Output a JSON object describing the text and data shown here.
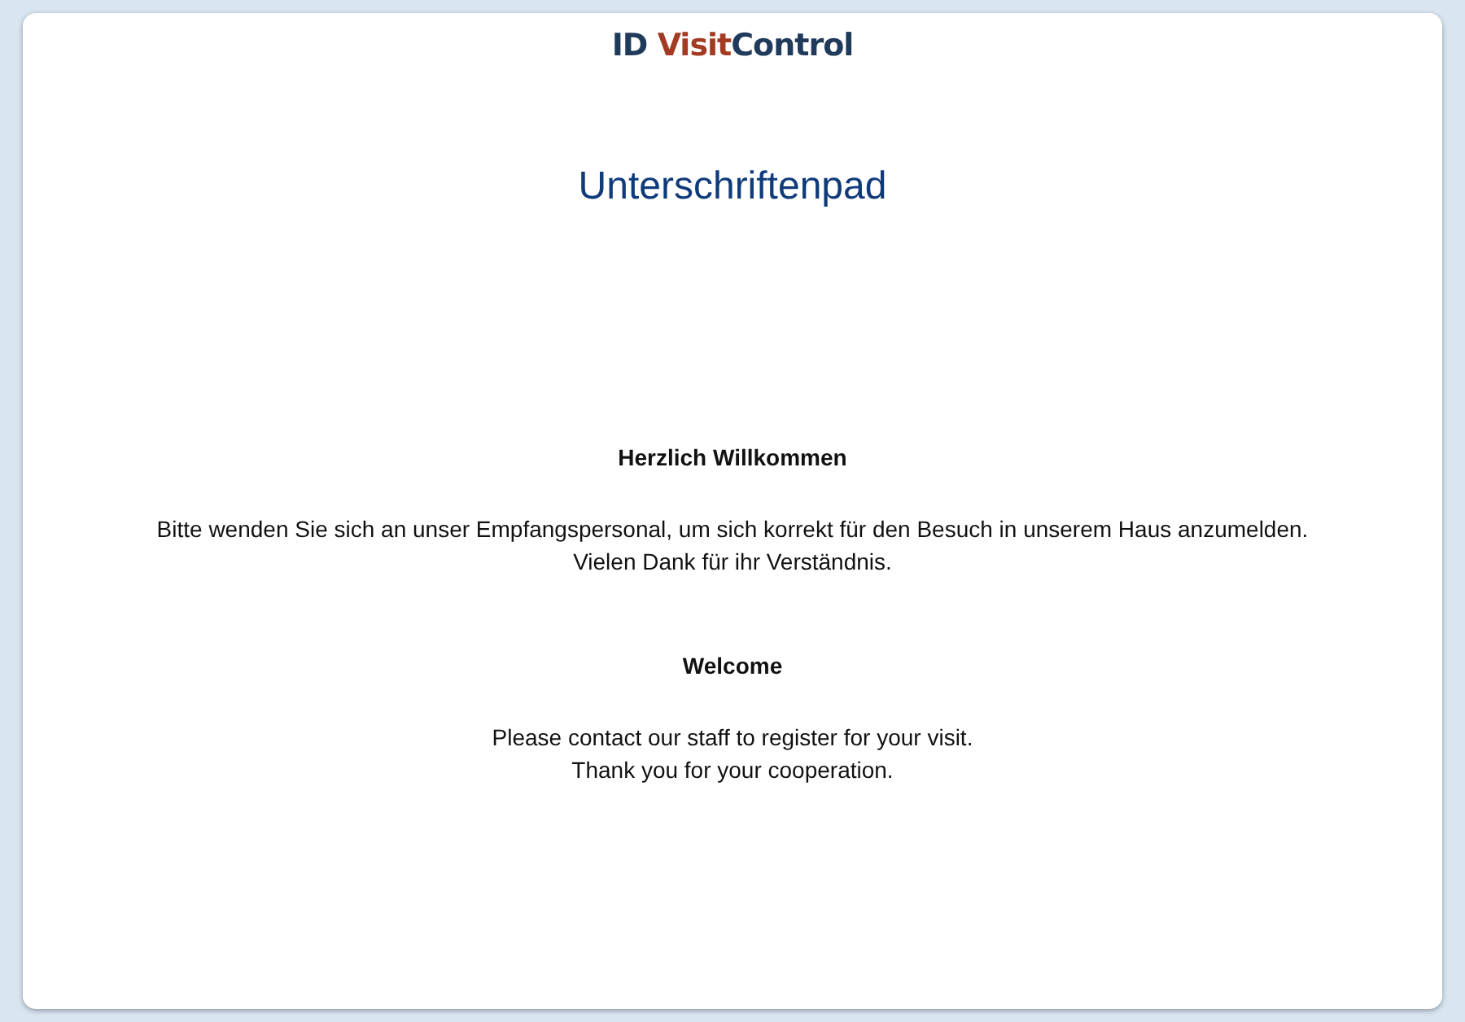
{
  "logo": {
    "parts": [
      {
        "text": "ID ",
        "color": "#1f3a5a"
      },
      {
        "text": "Visit",
        "color": "#a33a22"
      },
      {
        "text": "Control",
        "color": "#1f3a5a"
      }
    ]
  },
  "title": "Unterschriftenpad",
  "sections": [
    {
      "heading": "Herzlich Willkommen",
      "lines": [
        "Bitte wenden Sie sich an unser Empfangspersonal, um sich korrekt für den Besuch in unserem Haus anzumelden.",
        "Vielen Dank für ihr Verständnis."
      ]
    },
    {
      "heading": "Welcome",
      "lines": [
        "Please contact our staff to register for your visit.",
        "Thank you for your cooperation."
      ]
    }
  ]
}
